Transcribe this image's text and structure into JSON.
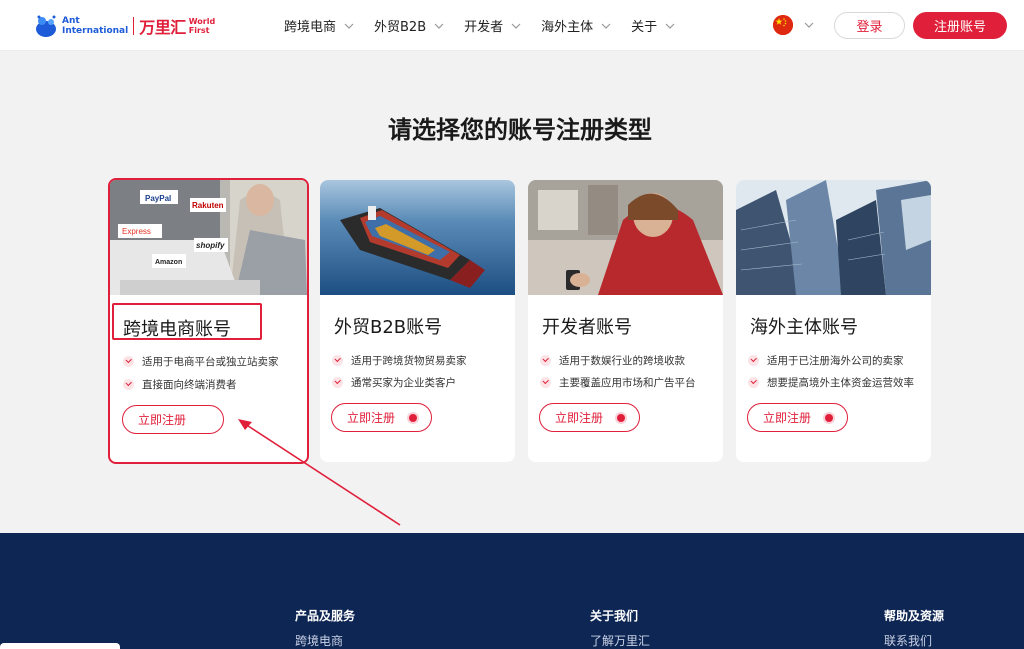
{
  "header": {
    "logo": {
      "ant_line1": "Ant",
      "ant_line2": "International",
      "cn": "万里汇",
      "wf_line1": "World",
      "wf_line2": "First"
    },
    "nav": [
      {
        "label": "跨境电商"
      },
      {
        "label": "外贸B2B"
      },
      {
        "label": "开发者"
      },
      {
        "label": "海外主体"
      },
      {
        "label": "关于"
      }
    ],
    "login_label": "登录",
    "register_label": "注册账号"
  },
  "page": {
    "title": "请选择您的账号注册类型"
  },
  "cards": [
    {
      "title": "跨境电商账号",
      "features": [
        "适用于电商平台或独立站卖家",
        "直接面向终端消费者"
      ],
      "cta": "立即注册",
      "image": "laptop-marketplaces",
      "logos": [
        "PayPal",
        "Rakuten",
        "Express",
        "shopify",
        "Amazon"
      ]
    },
    {
      "title": "外贸B2B账号",
      "features": [
        "适用于跨境货物贸易卖家",
        "通常买家为企业类客户"
      ],
      "cta": "立即注册",
      "image": "container-ship"
    },
    {
      "title": "开发者账号",
      "features": [
        "适用于数娱行业的跨境收款",
        "主要覆盖应用市场和广告平台"
      ],
      "cta": "立即注册",
      "image": "phone-user"
    },
    {
      "title": "海外主体账号",
      "features": [
        "适用于已注册海外公司的卖家",
        "想要提高境外主体资金运营效率"
      ],
      "cta": "立即注册",
      "image": "skyscrapers"
    }
  ],
  "footer": {
    "columns": [
      {
        "heading": "产品及服务",
        "link": "跨境电商"
      },
      {
        "heading": "关于我们",
        "link": "了解万里汇"
      },
      {
        "heading": "帮助及资源",
        "link": "联系我们"
      }
    ]
  },
  "colors": {
    "brand": "#e0203b",
    "footer_bg": "#0e2654",
    "page_bg": "#f2f2f3"
  }
}
